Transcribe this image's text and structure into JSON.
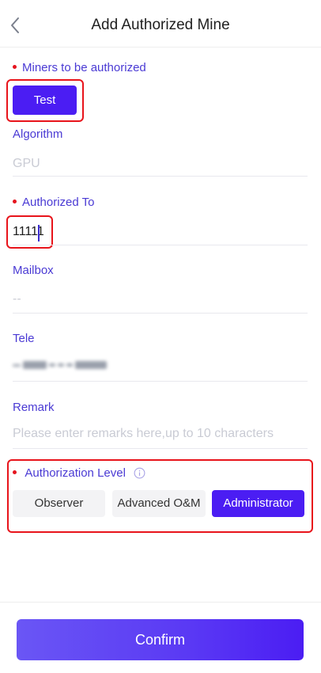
{
  "header": {
    "title": "Add Authorized Mine"
  },
  "miners": {
    "label": "Miners to be authorized",
    "tag": "Test"
  },
  "algorithm": {
    "label": "Algorithm",
    "value": "GPU"
  },
  "authorized_to": {
    "label": "Authorized To",
    "value": "11111"
  },
  "mailbox": {
    "label": "Mailbox",
    "value": "--"
  },
  "tele": {
    "label": "Tele"
  },
  "remark": {
    "label": "Remark",
    "placeholder": "Please enter remarks here,up to 10 characters"
  },
  "level": {
    "label": "Authorization Level",
    "options": [
      "Observer",
      "Advanced O&M",
      "Administrator"
    ],
    "selected": "Administrator"
  },
  "footer": {
    "confirm_label": "Confirm"
  },
  "colors": {
    "accent": "#4b1df3",
    "label": "#4a3ad4",
    "required_dot": "#e5141e",
    "highlight_box": "#e8141b"
  },
  "icons": {
    "back": "chevron-left-icon",
    "info": "info-icon"
  }
}
